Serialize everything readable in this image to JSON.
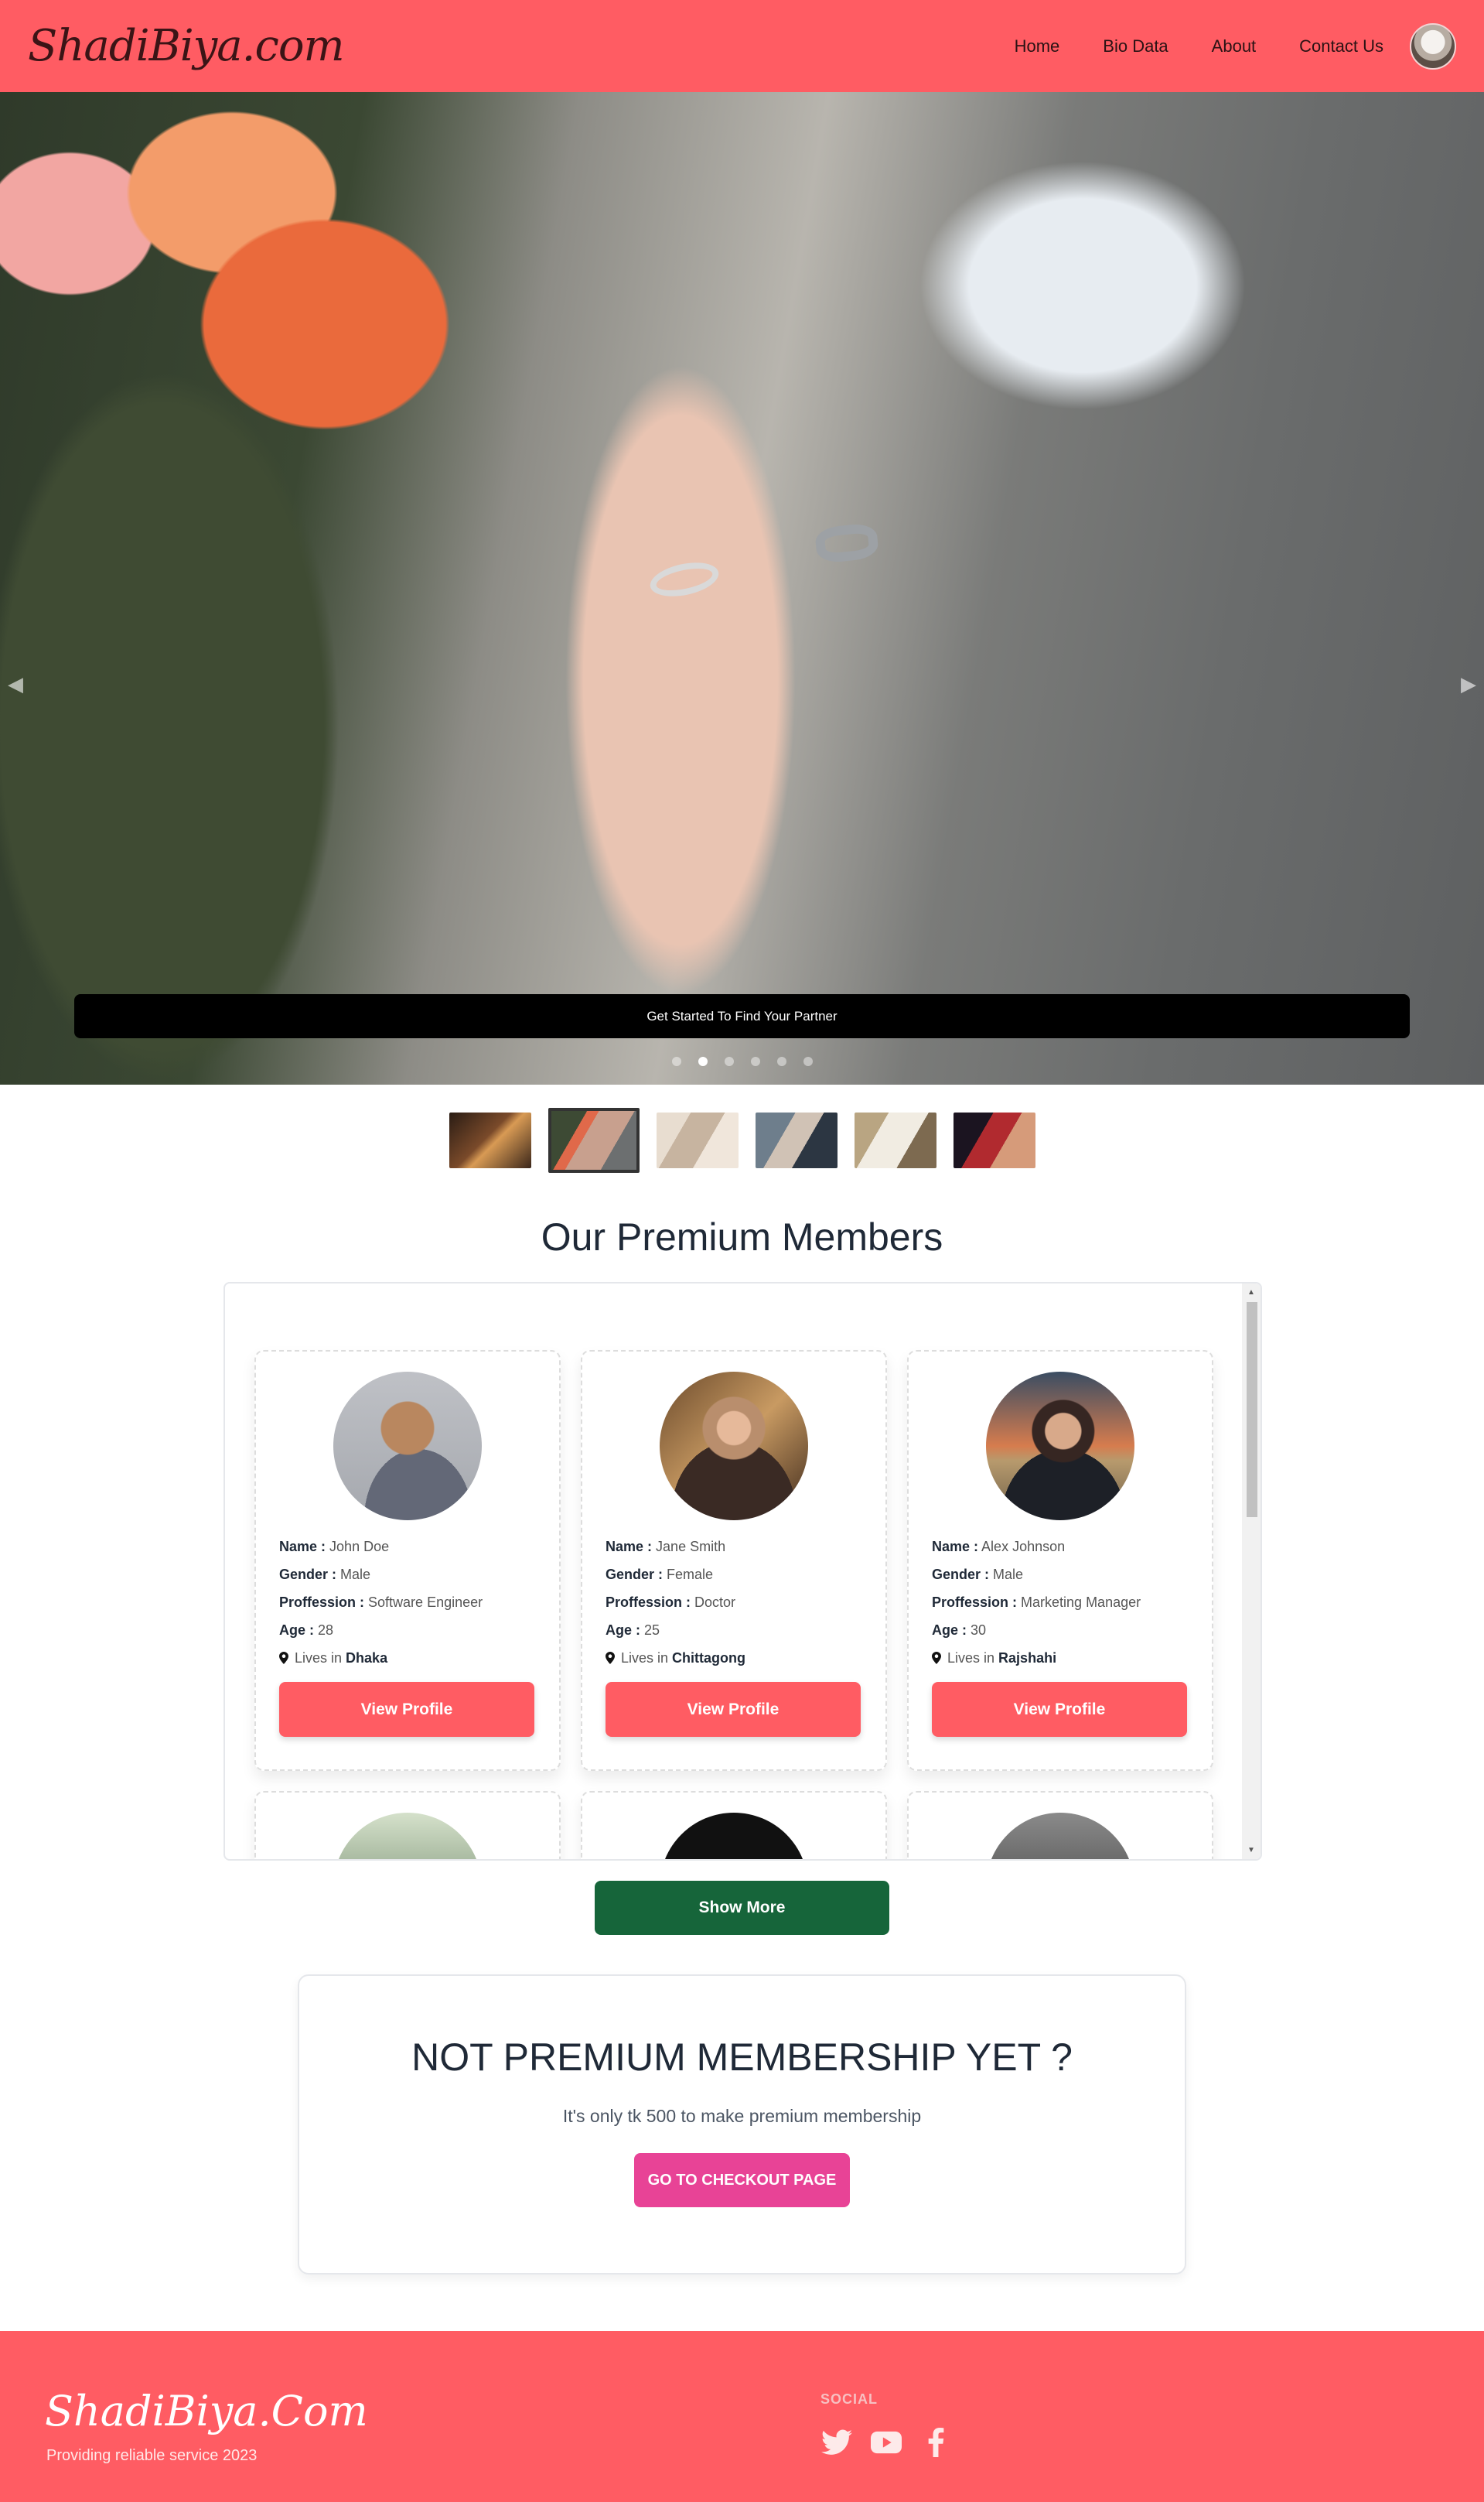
{
  "nav": {
    "logo": "ShadiBiya.com",
    "links": [
      "Home",
      "Bio Data",
      "About",
      "Contact Us"
    ]
  },
  "hero": {
    "cta": "Get Started To Find Your Partner",
    "slide_count": 6,
    "active_slide": 1
  },
  "premium": {
    "title": "Our Premium Members",
    "members": [
      {
        "name": "John Doe",
        "gender": "Male",
        "profession": "Software Engineer",
        "age": "28",
        "city": "Dhaka"
      },
      {
        "name": "Jane Smith",
        "gender": "Female",
        "profession": "Doctor",
        "age": "25",
        "city": "Chittagong"
      },
      {
        "name": "Alex Johnson",
        "gender": "Male",
        "profession": "Marketing Manager",
        "age": "30",
        "city": "Rajshahi"
      }
    ],
    "labels": {
      "name": "Name :",
      "gender": "Gender :",
      "profession": "Proffession :",
      "age": "Age :",
      "lives": "Lives in"
    },
    "view_profile": "View Profile",
    "show_more": "Show More"
  },
  "cta": {
    "title": "NOT PREMIUM MEMBERSHIP YET ?",
    "subtitle": "It's only tk 500 to make premium membership",
    "button": "GO TO CHECKOUT PAGE"
  },
  "footer": {
    "logo": "ShadiBiya.Com",
    "tagline": "Providing reliable service 2023",
    "social_heading": "SOCIAL",
    "icons": [
      "twitter-icon",
      "youtube-icon",
      "facebook-icon"
    ]
  },
  "colors": {
    "brand": "#ff5c63",
    "show_more": "#16653a",
    "checkout": "#e84396"
  }
}
